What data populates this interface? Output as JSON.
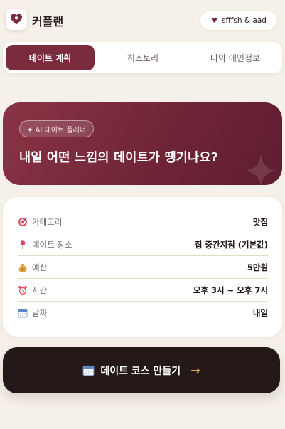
{
  "app": {
    "title": "커플랜"
  },
  "couple": {
    "names": "sfffsh & aad"
  },
  "tabs": [
    {
      "label": "데이트 계획",
      "active": true
    },
    {
      "label": "히스토리",
      "active": false
    },
    {
      "label": "나와 애인정보",
      "active": false
    }
  ],
  "hero": {
    "badge": "✦ AI 데이트 플래너",
    "title": "내일 어떤 느낌의 데이트가 땡기나요?"
  },
  "details": [
    {
      "icon": "target-icon",
      "label": "카테고리",
      "value": "맛집"
    },
    {
      "icon": "pin-icon",
      "label": "데이트 장소",
      "value": "집 중간지점 (기본값)"
    },
    {
      "icon": "money-bag-icon",
      "label": "예산",
      "value": "5만원"
    },
    {
      "icon": "alarm-clock-icon",
      "label": "시간",
      "value": "오후 3시 ~ 오후 7시"
    },
    {
      "icon": "calendar-icon",
      "label": "날짜",
      "value": "내일"
    }
  ],
  "cta": {
    "label": "데이트 코스 만들기"
  },
  "colors": {
    "accent": "#7a2b3c",
    "background": "#f6f1e8",
    "cta": "#251818",
    "arrow": "#d4a85a"
  }
}
